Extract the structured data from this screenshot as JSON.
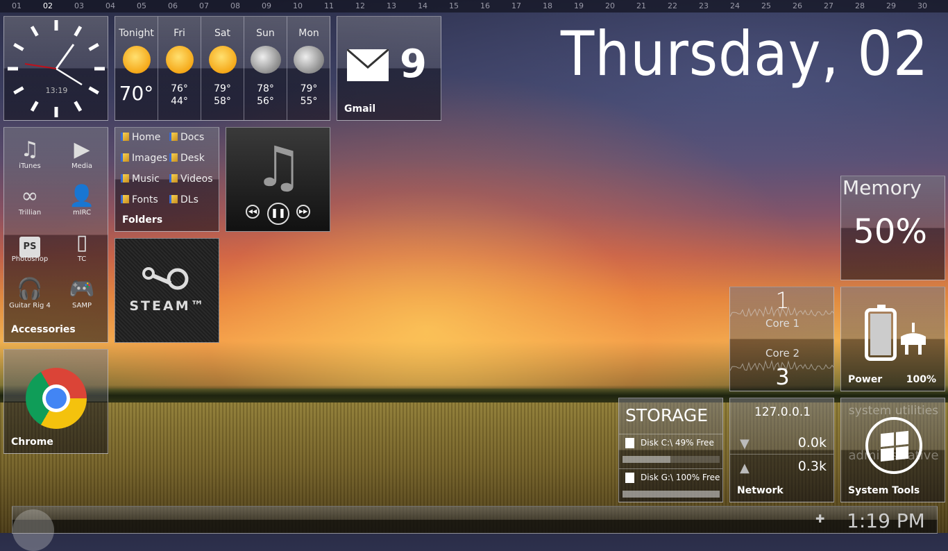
{
  "calendar": {
    "days": [
      "01",
      "02",
      "03",
      "04",
      "05",
      "06",
      "07",
      "08",
      "09",
      "10",
      "11",
      "12",
      "13",
      "14",
      "15",
      "16",
      "17",
      "18",
      "19",
      "20",
      "21",
      "22",
      "23",
      "24",
      "25",
      "26",
      "27",
      "28",
      "29",
      "30"
    ],
    "current": "02"
  },
  "date_heading": "Thursday, 02",
  "clock": {
    "digital": "13:19",
    "hours": 13,
    "minutes": 19
  },
  "weather": {
    "days": [
      {
        "label": "Tonight",
        "icon": "sunny-icon",
        "temp": "70°"
      },
      {
        "label": "Fri",
        "icon": "sunny-icon",
        "high": "76°",
        "low": "44°"
      },
      {
        "label": "Sat",
        "icon": "sunny-icon",
        "high": "79°",
        "low": "58°"
      },
      {
        "label": "Sun",
        "icon": "thunderstorm-icon",
        "high": "78°",
        "low": "56°"
      },
      {
        "label": "Mon",
        "icon": "thunderstorm-icon",
        "high": "79°",
        "low": "55°"
      }
    ]
  },
  "gmail": {
    "count": "9",
    "label": "Gmail"
  },
  "apps": {
    "items": [
      {
        "label": "iTunes",
        "icon": "music-note-icon"
      },
      {
        "label": "Media",
        "icon": "play-icon"
      },
      {
        "label": "Trillian",
        "icon": "trillian-icon"
      },
      {
        "label": "mIRC",
        "icon": "user-icon"
      },
      {
        "label": "Photoshop",
        "icon": "photoshop-icon",
        "glyph": "PS"
      },
      {
        "label": "TC",
        "icon": "phone-icon"
      },
      {
        "label": "Guitar Rig 4",
        "icon": "headphones-icon"
      },
      {
        "label": "SAMP",
        "icon": "gamepad-icon"
      }
    ],
    "title": "Accessories"
  },
  "folders": {
    "items": [
      "Home",
      "Docs",
      "Images",
      "Desk",
      "Music",
      "Videos",
      "Fonts",
      "DLs"
    ],
    "title": "Folders"
  },
  "steam": {
    "label": "STEAM™"
  },
  "chrome": {
    "label": "Chrome"
  },
  "memory": {
    "title": "Memory",
    "value": "50%"
  },
  "cpu": {
    "core1_value": "1",
    "core1_label": "Core 1",
    "core2_label": "Core 2",
    "core2_value": "3"
  },
  "power": {
    "label": "Power",
    "value": "100%",
    "level": 1.0
  },
  "storage": {
    "title": "STORAGE",
    "disks": [
      {
        "label": "Disk C:\\ 49% Free",
        "free": 0.49
      },
      {
        "label": "Disk G:\\ 100% Free",
        "free": 1.0
      }
    ]
  },
  "network": {
    "ip": "127.0.0.1",
    "down": "0.0k",
    "up": "0.3k",
    "label": "Network"
  },
  "system_tools": {
    "top": "system utilities",
    "middle": "administrative",
    "label": "System Tools"
  },
  "taskbar": {
    "time": "1:19 PM"
  }
}
